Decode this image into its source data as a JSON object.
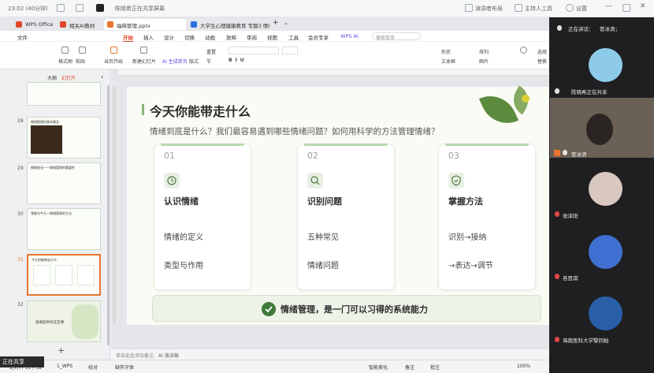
{
  "meeting_bar": {
    "time_label": "23:02 (40分钟)",
    "sharing_label": "陈晓希正在共享屏幕",
    "speaker_layout": "演讲者布局",
    "host_tools": "主持人工具",
    "settings": "设置"
  },
  "tabs": [
    {
      "label": "WPS Office",
      "color": "#e0462a"
    },
    {
      "label": "相关AI教材",
      "color": "#e0462a"
    },
    {
      "label": "福佛管理.pptx",
      "color": "#e8752f",
      "active": true
    },
    {
      "label": "大学生心理健康教育 专题3 情绪识别...",
      "color": "#2a6ee0"
    }
  ],
  "menu": [
    "文件",
    "开始",
    "插入",
    "设计",
    "切换",
    "动画",
    "放映",
    "审阅",
    "视图",
    "工具",
    "会员专享",
    "WPS AI"
  ],
  "search_placeholder": "搜索菜单",
  "ribbon": {
    "format_painter": "格式刷",
    "paste": "粘贴",
    "play": "当页开始",
    "new_slide": "新建幻灯片",
    "ai_gen": "AI 生成单页",
    "layout": "版式",
    "section": "节",
    "reset": "重置",
    "shape": "形状",
    "textbox": "文本框",
    "arrange": "排列",
    "picture": "图片",
    "select": "选择",
    "replace": "替换"
  },
  "sidebar": {
    "tab_outline": "大纲",
    "tab_slides": "幻灯片",
    "slides": [
      {
        "num": "28",
        "title": "情绪管理的基本概念"
      },
      {
        "num": "29",
        "title": "情绪变化——情绪管理的重要性"
      },
      {
        "num": "30",
        "title": "我能为今天一情绪管理的方法"
      },
      {
        "num": "31",
        "title": "今天你能带走什么"
      },
      {
        "num": "32",
        "title": "感谢您聆听这堂课"
      }
    ],
    "add": "+"
  },
  "slide": {
    "title": "今天你能带走什么",
    "subtitle": "情绪到底是什么？我们最容易遇到哪些情绪问题？如何用科学的方法管理情绪？",
    "cards": [
      {
        "num": "01",
        "title": "认识情绪",
        "icon": "clock-icon",
        "items": [
          "情绪的定义",
          "类型与作用"
        ]
      },
      {
        "num": "02",
        "title": "识别问题",
        "icon": "search-icon",
        "items": [
          "五种常见",
          "情绪问题"
        ]
      },
      {
        "num": "03",
        "title": "掌握方法",
        "icon": "shield-check-icon",
        "items": [
          "识别→接纳",
          "→表达→调节"
        ]
      }
    ],
    "banner": "情绪管理，是一门可以习得的系统能力"
  },
  "notes_placeholder": "单击此处添加备注",
  "ai_notes": "AI 演讲稿",
  "status": {
    "slide": "幻灯片 31 / 32",
    "theme": "1_WPS",
    "proofing": "校对",
    "missing_font": "缺失字体",
    "smart_beautify": "智能美化",
    "notes": "备注",
    "comments": "批注",
    "zoom": "100%"
  },
  "sharing_badge": "正在共享",
  "participants": {
    "speaking_label": "正在讲话：",
    "speaking_name": "管冰清；",
    "list": [
      {
        "name": "陈晓希正在共享",
        "color": "#8ecbea"
      },
      {
        "name": "管冰清",
        "color": "#6b6055"
      },
      {
        "name": "张泽阳",
        "color": "#d9c8c0"
      },
      {
        "name": "吝思琪",
        "color": "#3f6fd1"
      },
      {
        "name": "海南医科大学黎同柏",
        "color": "#2a5fa8"
      }
    ]
  }
}
